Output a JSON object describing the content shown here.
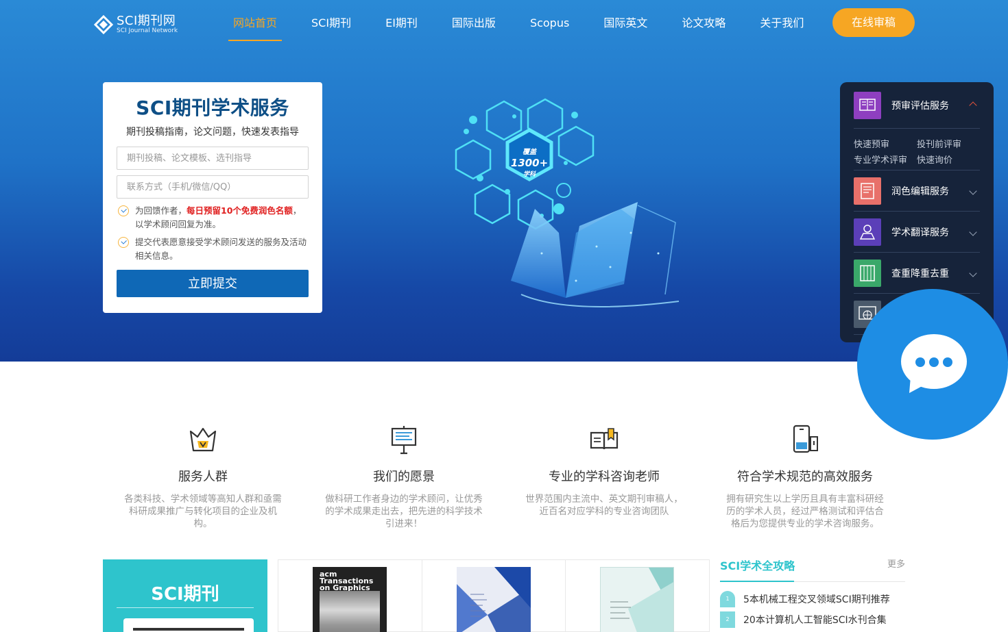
{
  "header": {
    "logo_title": "SCI期刊网",
    "logo_subtitle": "SCI Journal Network",
    "nav": [
      "网站首页",
      "SCI期刊",
      "EI期刊",
      "国际出版",
      "Scopus",
      "国际英文",
      "论文攻略",
      "关于我们"
    ],
    "active_nav": 0,
    "cta": "在线审稿"
  },
  "form": {
    "title": "SCI期刊学术服务",
    "subtitle": "期刊投稿指南，论文问题，快速发表指导",
    "input1_placeholder": "期刊投稿、论文模板、选刊指导",
    "input2_placeholder": "联系方式（手机/微信/QQ）",
    "notice1_pre": "为回馈作者，",
    "notice1_highlight": "每日预留10个免费润色名额",
    "notice1_post": "，以学术顾问回复为准。",
    "notice2": "提交代表愿意接受学术顾问发送的服务及活动相关信息。",
    "submit": "立即提交"
  },
  "illustration": {
    "badge_line1": "覆盖",
    "badge_line2": "1300+",
    "badge_line3": "学科"
  },
  "side_panel": {
    "items": [
      {
        "label": "预审评估服务",
        "expanded": true,
        "icon": "review-book-icon",
        "color": "#8e3fc0"
      },
      {
        "label": "润色编辑服务",
        "expanded": false,
        "icon": "edit-doc-icon",
        "color": "#e8706a"
      },
      {
        "label": "学术翻译服务",
        "expanded": false,
        "icon": "translate-icon",
        "color": "#5b3fb8"
      },
      {
        "label": "查重降重去重",
        "expanded": false,
        "icon": "check-doc-icon",
        "color": "#3aa86a"
      },
      {
        "label": "",
        "expanded": false,
        "icon": "globe-monitor-icon",
        "color": "#4a5a6c"
      }
    ],
    "subitems": [
      "快速预审",
      "投刊前评审",
      "专业学术评审",
      "快速询价"
    ]
  },
  "features": [
    {
      "title": "服务人群",
      "desc": "各类科技、学术领域等高知人群和亟需科研成果推广与转化项目的企业及机构。",
      "icon": "crown-icon"
    },
    {
      "title": "我们的愿景",
      "desc": "做科研工作者身边的学术顾问，让优秀的学术成果走出去，把先进的科学技术引进来！",
      "icon": "signboard-icon"
    },
    {
      "title": "专业的学科咨询老师",
      "desc": "世界范围内主流中、英文期刊审稿人，近百名对应学科的专业咨询团队",
      "icon": "open-book-icon"
    },
    {
      "title": "符合学术规范的高效服务",
      "desc": "拥有研究生以上学历且具有丰富科研经历的学术人员，经过严格测试和评估合格后为您提供专业的学术咨询服务。",
      "icon": "phone-icon"
    }
  ],
  "sci_box": {
    "title": "SCI期刊"
  },
  "journals": [
    {
      "cover_title": "acm Transactions on Graphics"
    },
    {
      "cover_title": ""
    },
    {
      "cover_title": ""
    }
  ],
  "strategy": {
    "title": "SCI学术全攻略",
    "more": "更多",
    "items": [
      {
        "num": "1",
        "text": "5本机械工程交叉领域SCI期刊推荐"
      },
      {
        "num": "2",
        "text": "20本计算机人工智能SCI水刊合集"
      }
    ]
  },
  "colors": {
    "accent": "#f6a623",
    "primary": "#0f68b6",
    "teal": "#2ec4cc",
    "panel": "#16233a",
    "chat": "#1e8de4"
  }
}
